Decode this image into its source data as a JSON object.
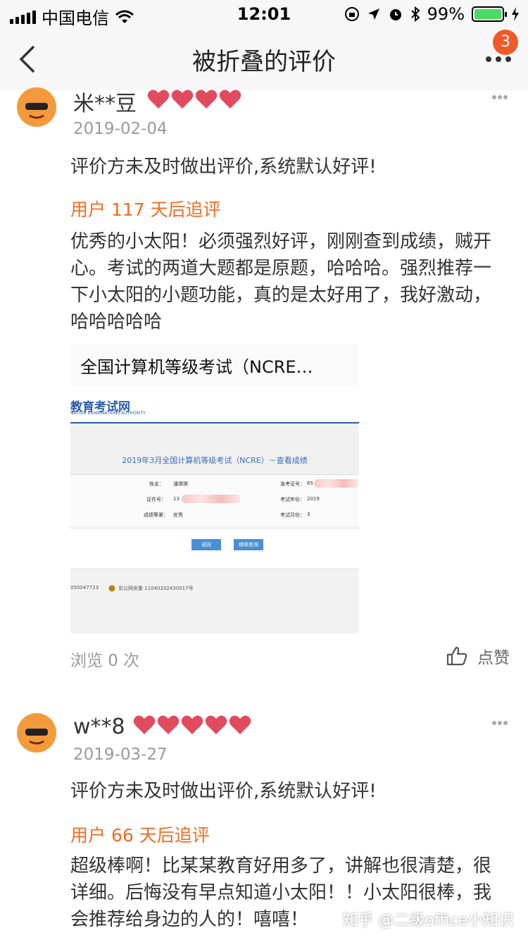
{
  "status_bar": {
    "carrier": "中国电信",
    "time": "12:01",
    "battery": "99%",
    "battery_level": 0.99
  },
  "nav": {
    "title": "被折叠的评价",
    "badge_count": "3"
  },
  "reviews": [
    {
      "username": "米**豆",
      "hearts": 4,
      "date": "2019-02-04",
      "default_text": "评价方未及时做出评价,系统默认好评!",
      "followup_label": "用户 117 天后追评",
      "followup_lines": [
        "优秀的小太阳！必须强烈好评，刚刚查到成绩，贼开",
        "心。考试的两道大题都是原题，哈哈哈。强烈推荐一",
        "下小太阳的小题功能，真的是太好用了，我好激动，",
        "哈哈哈哈哈"
      ],
      "image": {
        "header": "全国计算机等级考试（NCRE…",
        "logo": "教育考试网",
        "logo_sub": "NATION EXAMINATIONS AUTHORITY",
        "subtitle": "2019年3月全国计算机等级考试（NCRE）－查看成绩",
        "labels": [
          "姓名：",
          "证件号：",
          "成绩等第：",
          "准考证号：",
          "考试年份：",
          "考试月份："
        ],
        "values": [
          "潘琪琪",
          "13",
          "优秀",
          "65",
          "2019",
          "3"
        ],
        "buttons": [
          "返回",
          "继续查询"
        ],
        "footer_left": "050047723",
        "footer_right": "京公网安备 11040202430017号"
      },
      "views": "浏览 0 次",
      "like_label": "点赞"
    },
    {
      "username": "w**8",
      "hearts": 5,
      "date": "2019-03-27",
      "default_text": "评价方未及时做出评价,系统默认好评!",
      "followup_label": "用户 66 天后追评",
      "followup_lines": [
        "超级棒啊！比某某教育好用多了，讲解也很清楚，很",
        "详细。后悔没有早点知道小太阳！！小太阳很棒，我",
        "会推荐给身边的人的！嘻嘻！"
      ]
    }
  ],
  "watermark": "知乎 @二级office小知识",
  "colors": {
    "accent": "#f36b20",
    "badge": "#f05a28",
    "heart": "#e24a5e",
    "avatar": "#f39a3a"
  }
}
